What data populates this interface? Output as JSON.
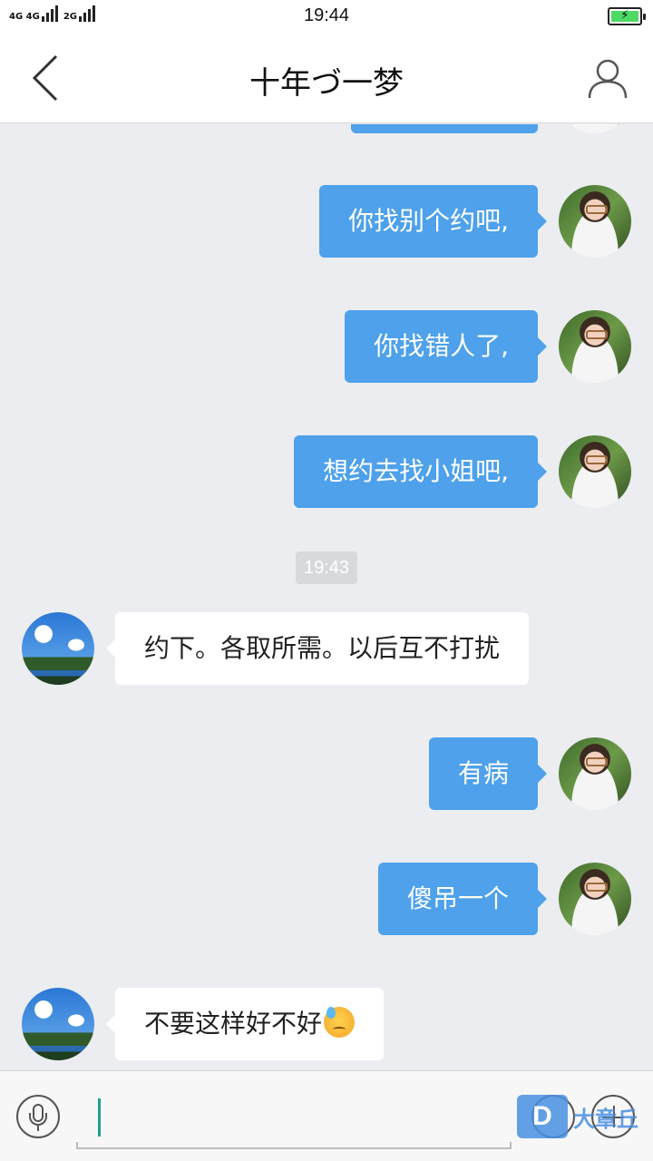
{
  "status_bar": {
    "signal_text": "4G 4G",
    "signal2_text": "2G",
    "time": "19:44",
    "battery_icon": "battery-charging-icon"
  },
  "header": {
    "back_icon": "chevron-left-icon",
    "title": "十年づ一梦",
    "profile_icon": "user-icon"
  },
  "messages": [
    {
      "side": "out",
      "text": "你找别个约吧,"
    },
    {
      "side": "out",
      "text": "你找错人了,"
    },
    {
      "side": "out",
      "text": "想约去找小姐吧,"
    },
    {
      "side": "in",
      "text": "约下。各取所需。以后互不打扰"
    },
    {
      "side": "out",
      "text": "有病"
    },
    {
      "side": "out",
      "text": "傻吊一个"
    },
    {
      "side": "in",
      "text": "不要这样好不好",
      "emoji": "sweat-emoji"
    }
  ],
  "timestamp": "19:43",
  "input_bar": {
    "mic_icon": "microphone-icon",
    "input_value": "",
    "emoji_icon": "emoji-icon",
    "plus_icon": "plus-icon",
    "watermark_text": "大章丘",
    "watermark_logo": "D"
  },
  "colors": {
    "outgoing_bubble": "#4ea1ea",
    "incoming_bubble": "#ffffff",
    "background": "#ebedf0"
  }
}
